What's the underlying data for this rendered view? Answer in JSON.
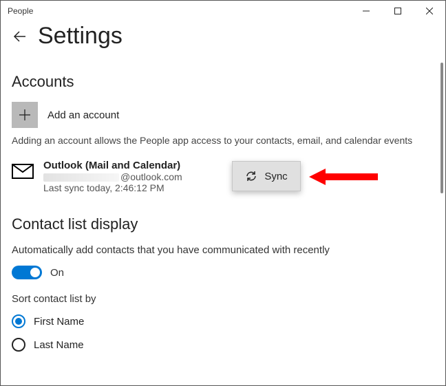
{
  "titlebar": {
    "app": "People"
  },
  "header": {
    "title": "Settings"
  },
  "accounts": {
    "heading": "Accounts",
    "add_label": "Add an account",
    "help": "Adding an account allows the People app access to your contacts, email, and calendar events",
    "item": {
      "name": "Outlook (Mail and Calendar)",
      "email_domain": "@outlook.com",
      "last_sync": "Last sync today, 2:46:12 PM"
    },
    "sync_label": "Sync"
  },
  "contacts": {
    "heading": "Contact list display",
    "auto_add_text": "Automatically add contacts that you have communicated with recently",
    "toggle_label": "On",
    "sort_label": "Sort contact list by",
    "sort_options": {
      "first": "First Name",
      "last": "Last Name"
    }
  }
}
